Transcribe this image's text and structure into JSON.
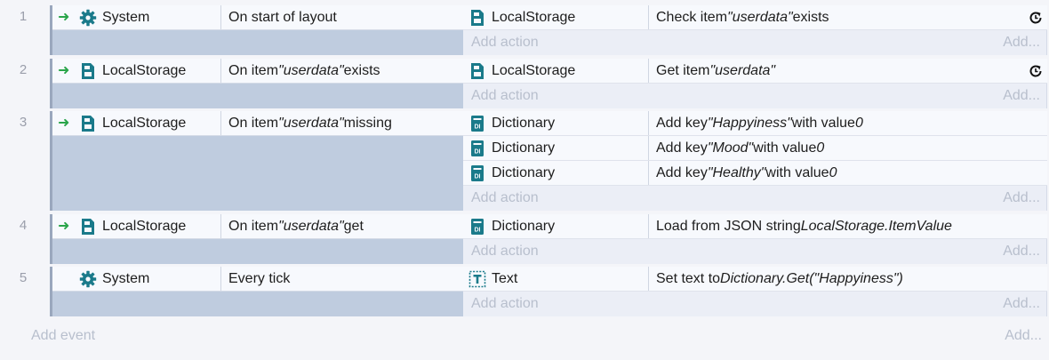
{
  "events": [
    {
      "number": "1",
      "condition": {
        "object": "System",
        "icon": "gear-icon",
        "parts": [
          "On start of layout"
        ]
      },
      "actions": [
        {
          "object": "LocalStorage",
          "icon": "localstorage-icon",
          "parts": [
            "Check item ",
            "\"userdata\"",
            " exists"
          ],
          "async": true
        }
      ],
      "add_action": "Add action",
      "add_more": "Add..."
    },
    {
      "number": "2",
      "condition": {
        "object": "LocalStorage",
        "icon": "localstorage-icon",
        "parts": [
          "On item ",
          "\"userdata\"",
          " exists"
        ]
      },
      "actions": [
        {
          "object": "LocalStorage",
          "icon": "localstorage-icon",
          "parts": [
            "Get item ",
            "\"userdata\"",
            ""
          ],
          "async": true
        }
      ],
      "add_action": "Add action",
      "add_more": "Add..."
    },
    {
      "number": "3",
      "condition": {
        "object": "LocalStorage",
        "icon": "localstorage-icon",
        "parts": [
          "On item ",
          "\"userdata\"",
          " missing"
        ]
      },
      "actions": [
        {
          "object": "Dictionary",
          "icon": "dictionary-icon",
          "parts": [
            "Add key ",
            "\"Happyiness\"",
            " with value ",
            "0"
          ]
        },
        {
          "object": "Dictionary",
          "icon": "dictionary-icon",
          "parts": [
            "Add key ",
            "\"Mood\"",
            " with value ",
            "0"
          ]
        },
        {
          "object": "Dictionary",
          "icon": "dictionary-icon",
          "parts": [
            "Add key ",
            "\"Healthy\"",
            " with value ",
            "0"
          ]
        }
      ],
      "add_action": "Add action",
      "add_more": "Add..."
    },
    {
      "number": "4",
      "condition": {
        "object": "LocalStorage",
        "icon": "localstorage-icon",
        "parts": [
          "On item ",
          "\"userdata\"",
          " get"
        ]
      },
      "actions": [
        {
          "object": "Dictionary",
          "icon": "dictionary-icon",
          "parts": [
            "Load from JSON string ",
            "LocalStorage.ItemValue"
          ]
        }
      ],
      "add_action": "Add action",
      "add_more": "Add..."
    },
    {
      "number": "5",
      "condition": {
        "object": "System",
        "icon": "gear-icon",
        "parts": [
          "Every tick"
        ],
        "no_arrow": true
      },
      "actions": [
        {
          "object": "Text",
          "icon": "text-object-icon",
          "parts": [
            "Set text to ",
            "Dictionary.Get(\"Happyiness\")"
          ]
        }
      ],
      "add_action": "Add action",
      "add_more": "Add..."
    }
  ],
  "footer": {
    "add_event": "Add event",
    "add_more": "Add..."
  },
  "colors": {
    "trigger_arrow": "#2aa54a",
    "icon_teal": "#1a7a8a",
    "panel": "#bfccdf"
  }
}
